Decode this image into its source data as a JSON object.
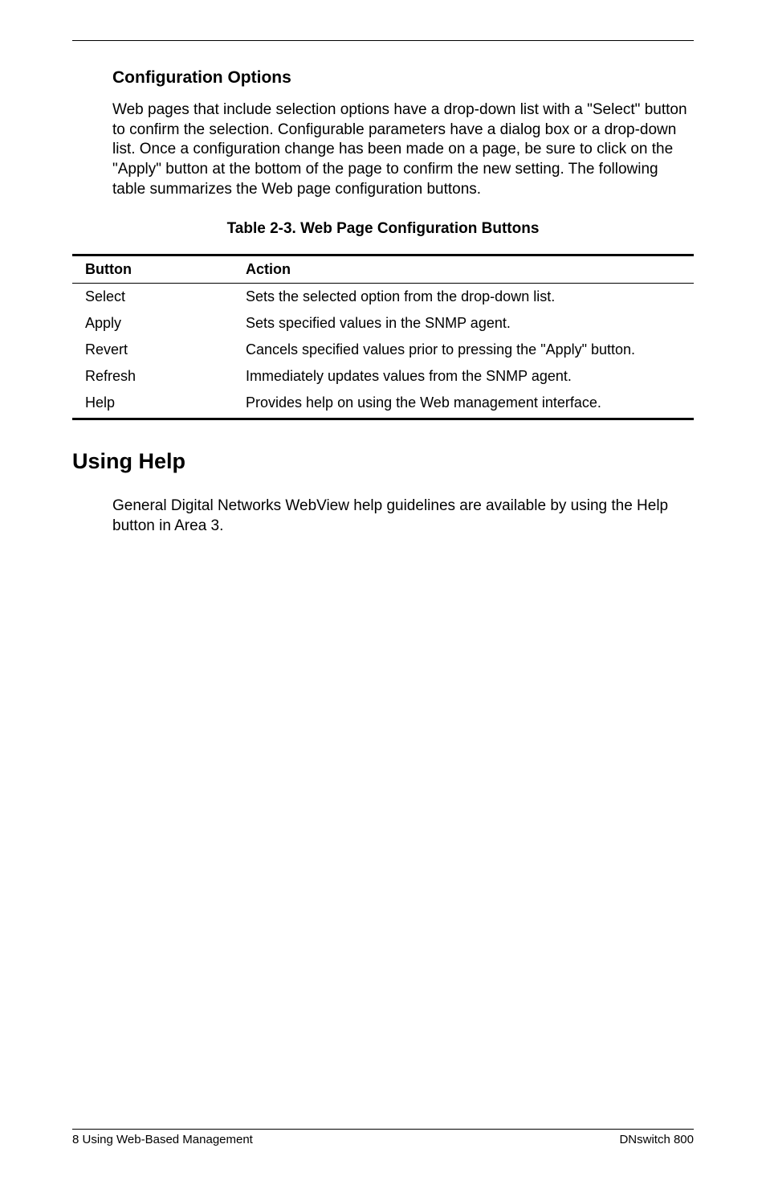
{
  "section": {
    "config_heading": "Configuration Options",
    "config_body": "Web pages that include selection options have a drop-down list with a \"Select\" button to confirm the selection. Configurable parameters have a dialog box or a drop-down list. Once a configuration change has been made on a page, be sure to click on the \"Apply\" button at the bottom of the page to confirm the new setting. The following table summarizes the Web page configuration buttons."
  },
  "table": {
    "caption": "Table 2-3.  Web Page Configuration Buttons",
    "headers": {
      "button": "Button",
      "action": "Action"
    },
    "rows": [
      {
        "button": "Select",
        "action": "Sets the selected option from the drop-down list."
      },
      {
        "button": "Apply",
        "action": "Sets specified values in the SNMP agent."
      },
      {
        "button": "Revert",
        "action": "Cancels specified values prior to pressing the \"Apply\" button."
      },
      {
        "button": "Refresh",
        "action": "Immediately updates values from the SNMP agent."
      },
      {
        "button": "Help",
        "action": "Provides help on using the Web management interface."
      }
    ]
  },
  "help": {
    "heading": "Using Help",
    "body": "General Digital Networks WebView help guidelines are available by using the Help button in Area 3."
  },
  "footer": {
    "left": "8  Using Web-Based Management",
    "right": "DNswitch 800"
  }
}
